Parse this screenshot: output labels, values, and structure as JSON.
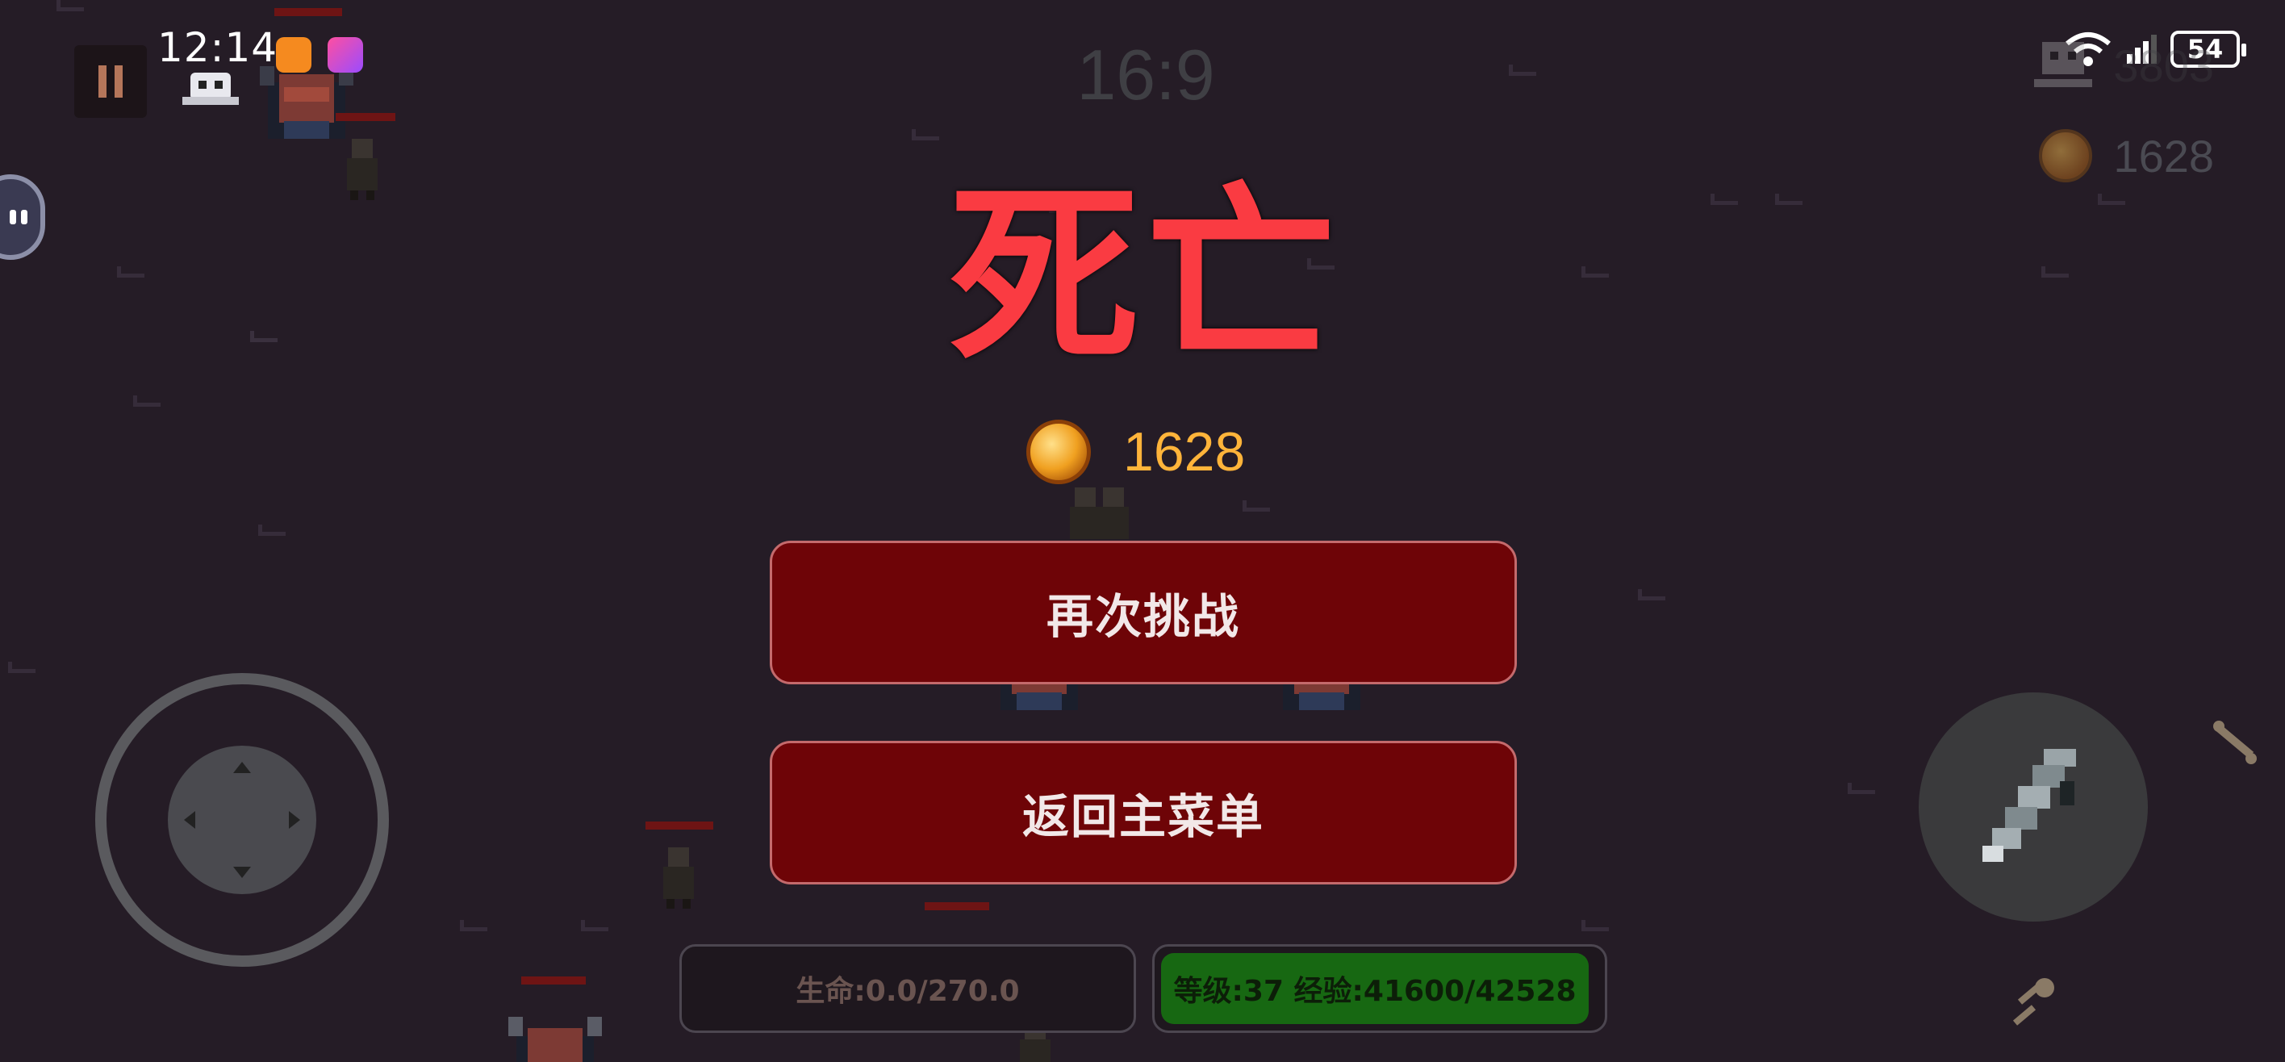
{
  "status_bar": {
    "time": "12:14",
    "battery": "54"
  },
  "hud": {
    "timer": "16:9",
    "kills": "3803",
    "gold": "1628"
  },
  "death_screen": {
    "title": "死亡",
    "gold_earned": "1628",
    "retry_label": "再次挑战",
    "main_menu_label": "返回主菜单"
  },
  "bottom_bar": {
    "hp_text": "生命:0.0/270.0",
    "xp_text": "等级:37 经验:41600/42528",
    "xp_progress": 0.978
  },
  "colors": {
    "background": "#251c26",
    "title_red": "#fa3b42",
    "button_red": "#6e0407",
    "gold": "#ffb43a",
    "xp_green": "#176812"
  },
  "icons": {
    "pause": "pause-icon",
    "skull": "skull-icon",
    "coin": "coin-icon",
    "weapon": "dagger-icon",
    "wifi": "wifi-icon",
    "signal": "signal-icon",
    "battery": "battery-icon"
  }
}
